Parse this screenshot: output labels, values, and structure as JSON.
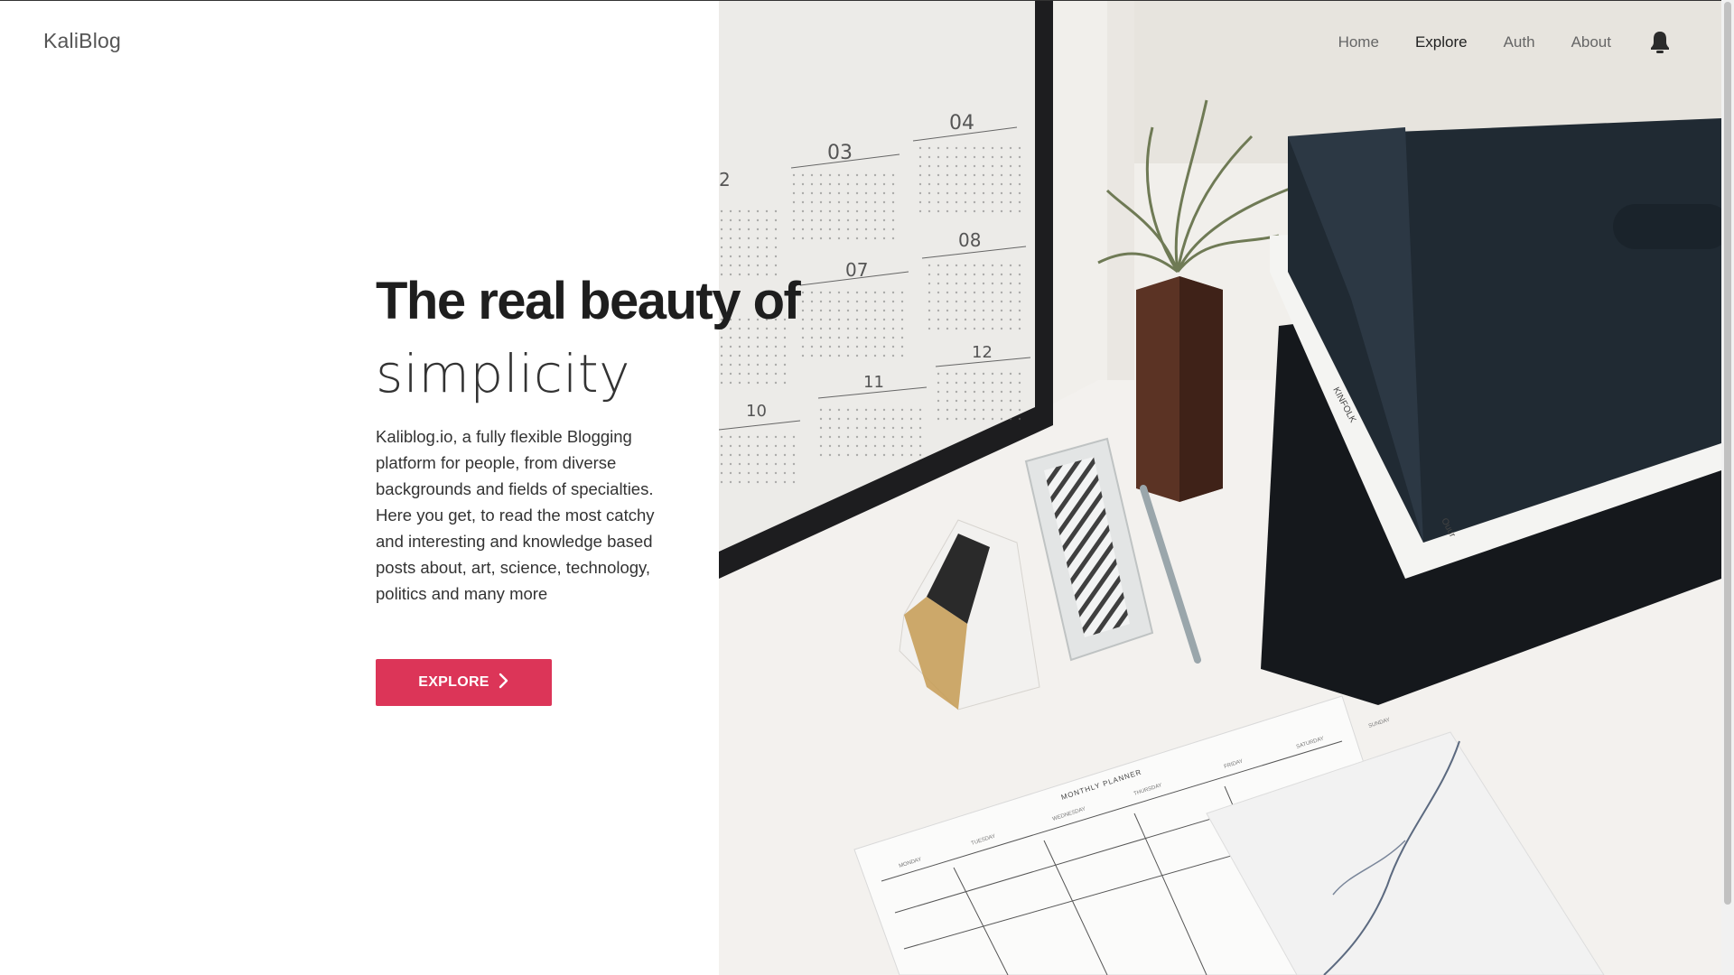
{
  "brand": {
    "name": "KaliBlog"
  },
  "nav": {
    "items": [
      {
        "label": "Home"
      },
      {
        "label": "Explore",
        "active": true
      },
      {
        "label": "Auth"
      },
      {
        "label": "About"
      }
    ],
    "user_icon": "user-icon"
  },
  "hero": {
    "headline": "The real beauty of",
    "subhead": "simplicity",
    "description": "Kaliblog.io, a fully flexible Blogging platform for people, from diverse backgrounds and fields of specialties. Here you get, to read the most catchy and interesting and knowledge based posts about, art, science, technology, politics and many more",
    "cta_label": "EXPLORE",
    "cta_icon": "chevron-right-icon"
  },
  "image": {
    "calendar_months": [
      "03",
      "04",
      "07",
      "08",
      "11",
      "10",
      "12",
      "2"
    ],
    "planner_title": "MONTHLY PLANNER",
    "planner_days": [
      "MONDAY",
      "TUESDAY",
      "WEDNESDAY",
      "THURSDAY",
      "FRIDAY",
      "SATURDAY",
      "SUNDAY"
    ],
    "book_spine": "KINFOLK",
    "book_spine_2": "Ouur"
  },
  "colors": {
    "accent": "#dc3558",
    "text": "#222222",
    "nav_muted": "#666666"
  }
}
